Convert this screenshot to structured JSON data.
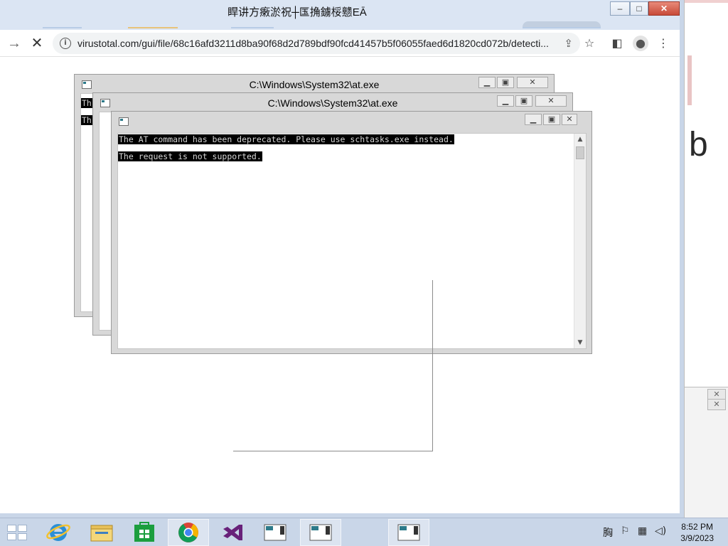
{
  "browser": {
    "window_title": "睅讲方瘷淤祝┼匤捔鐪桵戆EĀ",
    "url": "virustotal.com/gui/file/68c16afd3211d8ba90f68d2d789bdf90fcd41457b5f06055faed6d1820cd072b/detecti...",
    "icons": {
      "forward": "forward-arrow-icon",
      "stop": "stop-loading-icon",
      "info": "site-info-icon",
      "share": "share-icon",
      "bookmark": "bookmark-star-icon",
      "side_panel": "side-panel-icon",
      "profile": "profile-icon",
      "menu": "kebab-menu-icon"
    }
  },
  "console_windows": [
    {
      "title": "C:\\Windows\\System32\\at.exe",
      "lines": [
        "Th",
        "Th"
      ]
    },
    {
      "title": "C:\\Windows\\System32\\at.exe",
      "lines": []
    },
    {
      "title": "",
      "lines": [
        "The AT command has been deprecated. Please use schtasks.exe instead.",
        "The request is not supported."
      ]
    }
  ],
  "background_window": {
    "partial_text": "b"
  },
  "taskbar": {
    "items": [
      {
        "name": "start-button",
        "icon": "windows-logo-icon"
      },
      {
        "name": "internet-explorer",
        "icon": "ie-icon"
      },
      {
        "name": "file-explorer",
        "icon": "folder-icon"
      },
      {
        "name": "windows-store",
        "icon": "store-icon"
      },
      {
        "name": "chrome",
        "icon": "chrome-icon"
      },
      {
        "name": "visual-studio",
        "icon": "visual-studio-icon"
      },
      {
        "name": "console-1",
        "icon": "console-window-icon"
      },
      {
        "name": "console-2",
        "icon": "console-window-icon"
      },
      {
        "name": "console-3",
        "icon": "console-window-icon"
      }
    ],
    "tray": {
      "ime": "胸",
      "time": "8:52 PM",
      "date": "3/9/2023"
    }
  },
  "colors": {
    "taskbar": "#c9d6e8",
    "console_bg": "#000000",
    "console_fg": "#d6d6d6"
  }
}
